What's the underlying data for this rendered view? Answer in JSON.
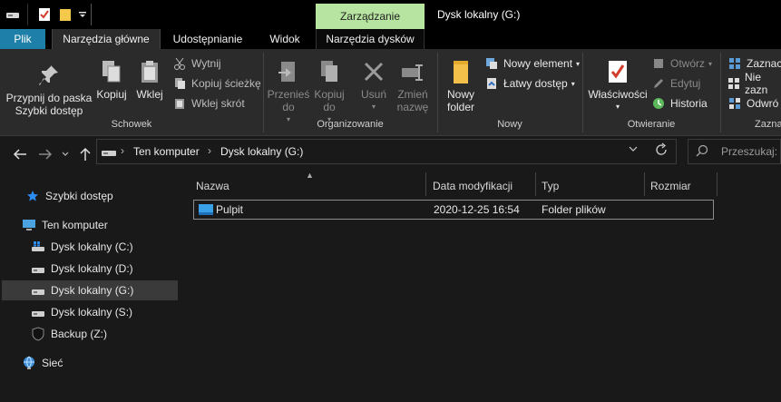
{
  "titlebar": {
    "context_tab": "Zarządzanie",
    "window_title": "Dysk lokalny (G:)"
  },
  "tabs": {
    "file": "Plik",
    "home": "Narzędzia główne",
    "share": "Udostępnianie",
    "view": "Widok",
    "drive_tools": "Narzędzia dysków"
  },
  "ribbon": {
    "clipboard": {
      "pin": "Przypnij do paska Szybki dostęp",
      "copy": "Kopiuj",
      "paste": "Wklej",
      "cut": "Wytnij",
      "copy_path": "Kopiuj ścieżkę",
      "paste_shortcut": "Wklej skrót",
      "group": "Schowek"
    },
    "organize": {
      "move_to": "Przenieś do",
      "copy_to": "Kopiuj do",
      "delete": "Usuń",
      "rename": "Zmień nazwę",
      "group": "Organizowanie"
    },
    "new": {
      "new_folder": "Nowy folder",
      "new_item": "Nowy element",
      "easy_access": "Łatwy dostęp",
      "group": "Nowy"
    },
    "open": {
      "properties": "Właściwości",
      "open": "Otwórz",
      "edit": "Edytuj",
      "history": "Historia",
      "group": "Otwieranie"
    },
    "select": {
      "select_all": "Zaznacz",
      "select_none": "Nie zazn",
      "invert": "Odwró",
      "group": "Zazna"
    }
  },
  "address": {
    "crumbs": [
      "Ten komputer",
      "Dysk lokalny (G:)"
    ]
  },
  "search": {
    "placeholder": "Przeszukaj: D"
  },
  "sidebar": {
    "items": [
      {
        "label": "Szybki dostęp",
        "icon": "star-icon"
      },
      {
        "label": "Ten komputer",
        "icon": "computer-icon"
      },
      {
        "label": "Dysk lokalny (C:)",
        "icon": "windows-drive-icon"
      },
      {
        "label": "Dysk lokalny (D:)",
        "icon": "drive-icon"
      },
      {
        "label": "Dysk lokalny (G:)",
        "icon": "drive-icon"
      },
      {
        "label": "Dysk lokalny (S:)",
        "icon": "drive-icon"
      },
      {
        "label": "Backup (Z:)",
        "icon": "shield-drive-icon"
      },
      {
        "label": "Sieć",
        "icon": "network-icon"
      }
    ]
  },
  "columns": {
    "name": "Nazwa",
    "date": "Data modyfikacji",
    "type": "Typ",
    "size": "Rozmiar"
  },
  "files": [
    {
      "name": "Pulpit",
      "date": "2020-12-25 16:54",
      "type": "Folder plików",
      "size": ""
    }
  ],
  "colors": {
    "file_tab": "#1e80a8",
    "context_tab": "#b7e4a0",
    "selection": "#3a3a3a",
    "background": "#191919"
  }
}
